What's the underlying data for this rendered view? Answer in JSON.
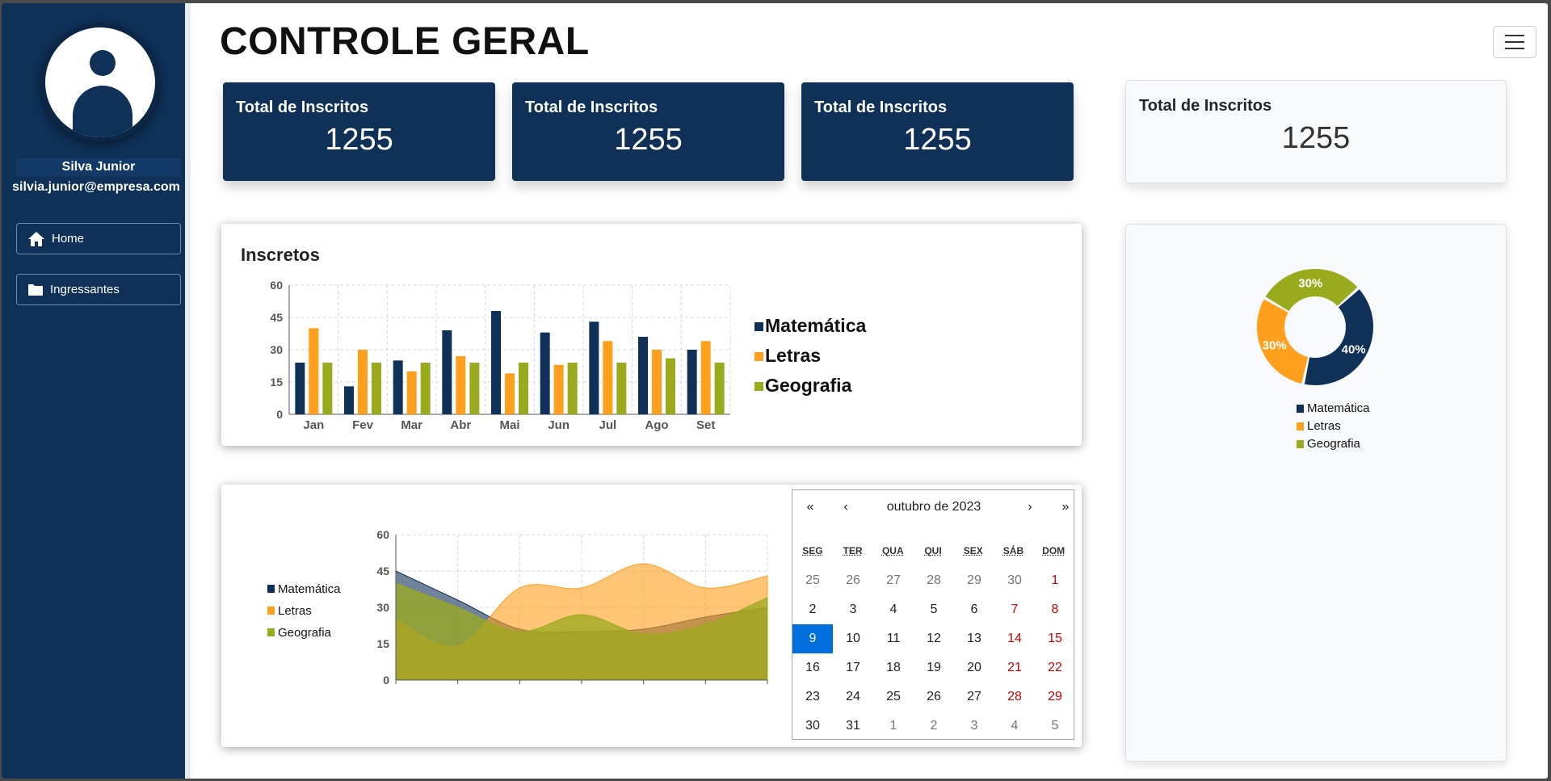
{
  "colors": {
    "navy": "#0f3057",
    "orange": "#ff9f1c",
    "olive": "#99aa1c",
    "weekend": "#d10000",
    "selected": "#006edc"
  },
  "user": {
    "name": "Silva Junior",
    "email": "silvia.junior@empresa.com",
    "avatar_icon": "user-icon"
  },
  "nav": {
    "home": {
      "label": "Home",
      "icon": "home-icon"
    },
    "ingressantes": {
      "label": "Ingressantes",
      "icon": "folder-icon"
    }
  },
  "header": {
    "title": "CONTROLE GERAL",
    "menu_icon": "hamburger-menu-icon"
  },
  "stats": [
    {
      "label": "Total de Inscritos",
      "value": "1255"
    },
    {
      "label": "Total de Inscritos",
      "value": "1255"
    },
    {
      "label": "Total de Inscritos",
      "value": "1255"
    },
    {
      "label": "Total de Inscritos",
      "value": "1255"
    }
  ],
  "bar_panel": {
    "title": "Inscretos"
  },
  "chart_data": [
    {
      "type": "bar",
      "title": "Inscretos",
      "categories": [
        "Jan",
        "Fev",
        "Mar",
        "Abr",
        "Mai",
        "Jun",
        "Jul",
        "Ago",
        "Set"
      ],
      "series": [
        {
          "name": "Matemática",
          "values": [
            24,
            13,
            25,
            39,
            48,
            38,
            43,
            36,
            30
          ]
        },
        {
          "name": "Letras",
          "values": [
            40,
            30,
            20,
            27,
            19,
            23,
            34,
            30,
            34
          ]
        },
        {
          "name": "Geografia",
          "values": [
            24,
            24,
            24,
            24,
            24,
            24,
            24,
            26,
            24
          ]
        }
      ],
      "yticks": [
        0,
        15,
        30,
        45,
        60
      ],
      "ylim": [
        0,
        60
      ],
      "grid": true,
      "legend": "right"
    },
    {
      "type": "area",
      "x": [
        0,
        1,
        2,
        3,
        4,
        5,
        6
      ],
      "series": [
        {
          "name": "Matemática",
          "values": [
            45,
            33,
            21,
            20,
            21,
            26,
            30
          ]
        },
        {
          "name": "Letras",
          "values": [
            25,
            14,
            38,
            38,
            48,
            38,
            43
          ]
        },
        {
          "name": "Geografia",
          "values": [
            40,
            30,
            20,
            27,
            19,
            23,
            34
          ]
        }
      ],
      "yticks": [
        0,
        15,
        30,
        45,
        60
      ],
      "ylim": [
        0,
        60
      ],
      "grid": true,
      "legend": "left"
    },
    {
      "type": "pie",
      "series": [
        {
          "name": "Matemática",
          "value": 40,
          "label": "40%"
        },
        {
          "name": "Letras",
          "value": 30,
          "label": "30%"
        },
        {
          "name": "Geografia",
          "value": 30,
          "label": "30%"
        }
      ],
      "legend": "bottom"
    }
  ],
  "calendar": {
    "month_label": "outubro de 2023",
    "prev_year": "«",
    "prev": "‹",
    "next": "›",
    "next_year": "»",
    "weekdays": [
      "SEG",
      "TER",
      "QUA",
      "QUI",
      "SEX",
      "SÁB",
      "DOM"
    ],
    "days": [
      {
        "d": "25",
        "other": true
      },
      {
        "d": "26",
        "other": true
      },
      {
        "d": "27",
        "other": true
      },
      {
        "d": "28",
        "other": true
      },
      {
        "d": "29",
        "other": true
      },
      {
        "d": "30",
        "other": true
      },
      {
        "d": "1",
        "weekend": true
      },
      {
        "d": "2"
      },
      {
        "d": "3"
      },
      {
        "d": "4"
      },
      {
        "d": "5"
      },
      {
        "d": "6"
      },
      {
        "d": "7",
        "weekend": true
      },
      {
        "d": "8",
        "weekend": true
      },
      {
        "d": "9",
        "selected": true
      },
      {
        "d": "10"
      },
      {
        "d": "11"
      },
      {
        "d": "12"
      },
      {
        "d": "13"
      },
      {
        "d": "14",
        "weekend": true
      },
      {
        "d": "15",
        "weekend": true
      },
      {
        "d": "16"
      },
      {
        "d": "17"
      },
      {
        "d": "18"
      },
      {
        "d": "19"
      },
      {
        "d": "20"
      },
      {
        "d": "21",
        "weekend": true
      },
      {
        "d": "22",
        "weekend": true
      },
      {
        "d": "23"
      },
      {
        "d": "24"
      },
      {
        "d": "25"
      },
      {
        "d": "26"
      },
      {
        "d": "27"
      },
      {
        "d": "28",
        "weekend": true
      },
      {
        "d": "29",
        "weekend": true
      },
      {
        "d": "30"
      },
      {
        "d": "31"
      },
      {
        "d": "1",
        "other": true
      },
      {
        "d": "2",
        "other": true
      },
      {
        "d": "3",
        "other": true
      },
      {
        "d": "4",
        "other": true
      },
      {
        "d": "5",
        "other": true
      }
    ]
  }
}
